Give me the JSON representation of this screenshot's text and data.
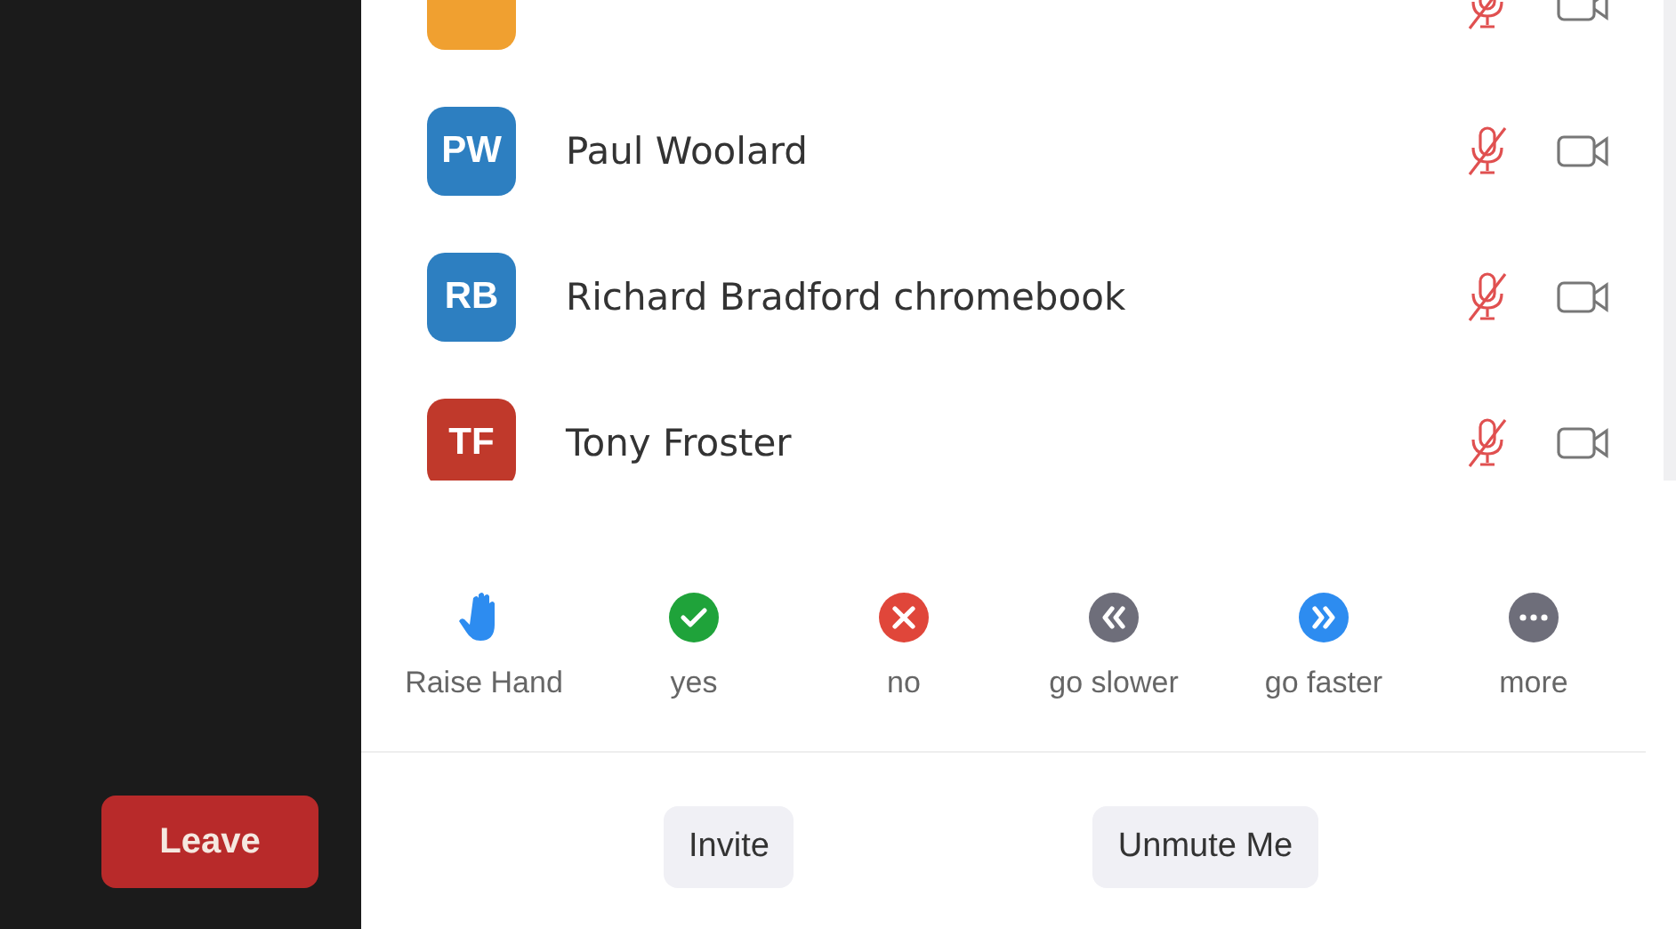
{
  "sidebar": {
    "leave_button": "Leave"
  },
  "participants": [
    {
      "kind": "clipped",
      "color": "#f0a030",
      "muted": true
    },
    {
      "kind": "full",
      "initials": "PW",
      "name": "Paul Woolard",
      "color": "#2d7fc1",
      "muted": true
    },
    {
      "kind": "full",
      "initials": "RB",
      "name": "Richard Bradford chromebook",
      "color": "#2d7fc1",
      "muted": true
    },
    {
      "kind": "full",
      "initials": "TF",
      "name": "Tony Froster",
      "color": "#c0392b",
      "muted": true
    }
  ],
  "reactions": [
    {
      "kind": "hand",
      "label": "Raise Hand"
    },
    {
      "kind": "check",
      "label": "yes"
    },
    {
      "kind": "cross",
      "label": "no"
    },
    {
      "kind": "slower",
      "label": "go slower"
    },
    {
      "kind": "faster",
      "label": "go faster"
    },
    {
      "kind": "more",
      "label": "more"
    }
  ],
  "buttons": [
    "Invite",
    "Unmute Me"
  ]
}
